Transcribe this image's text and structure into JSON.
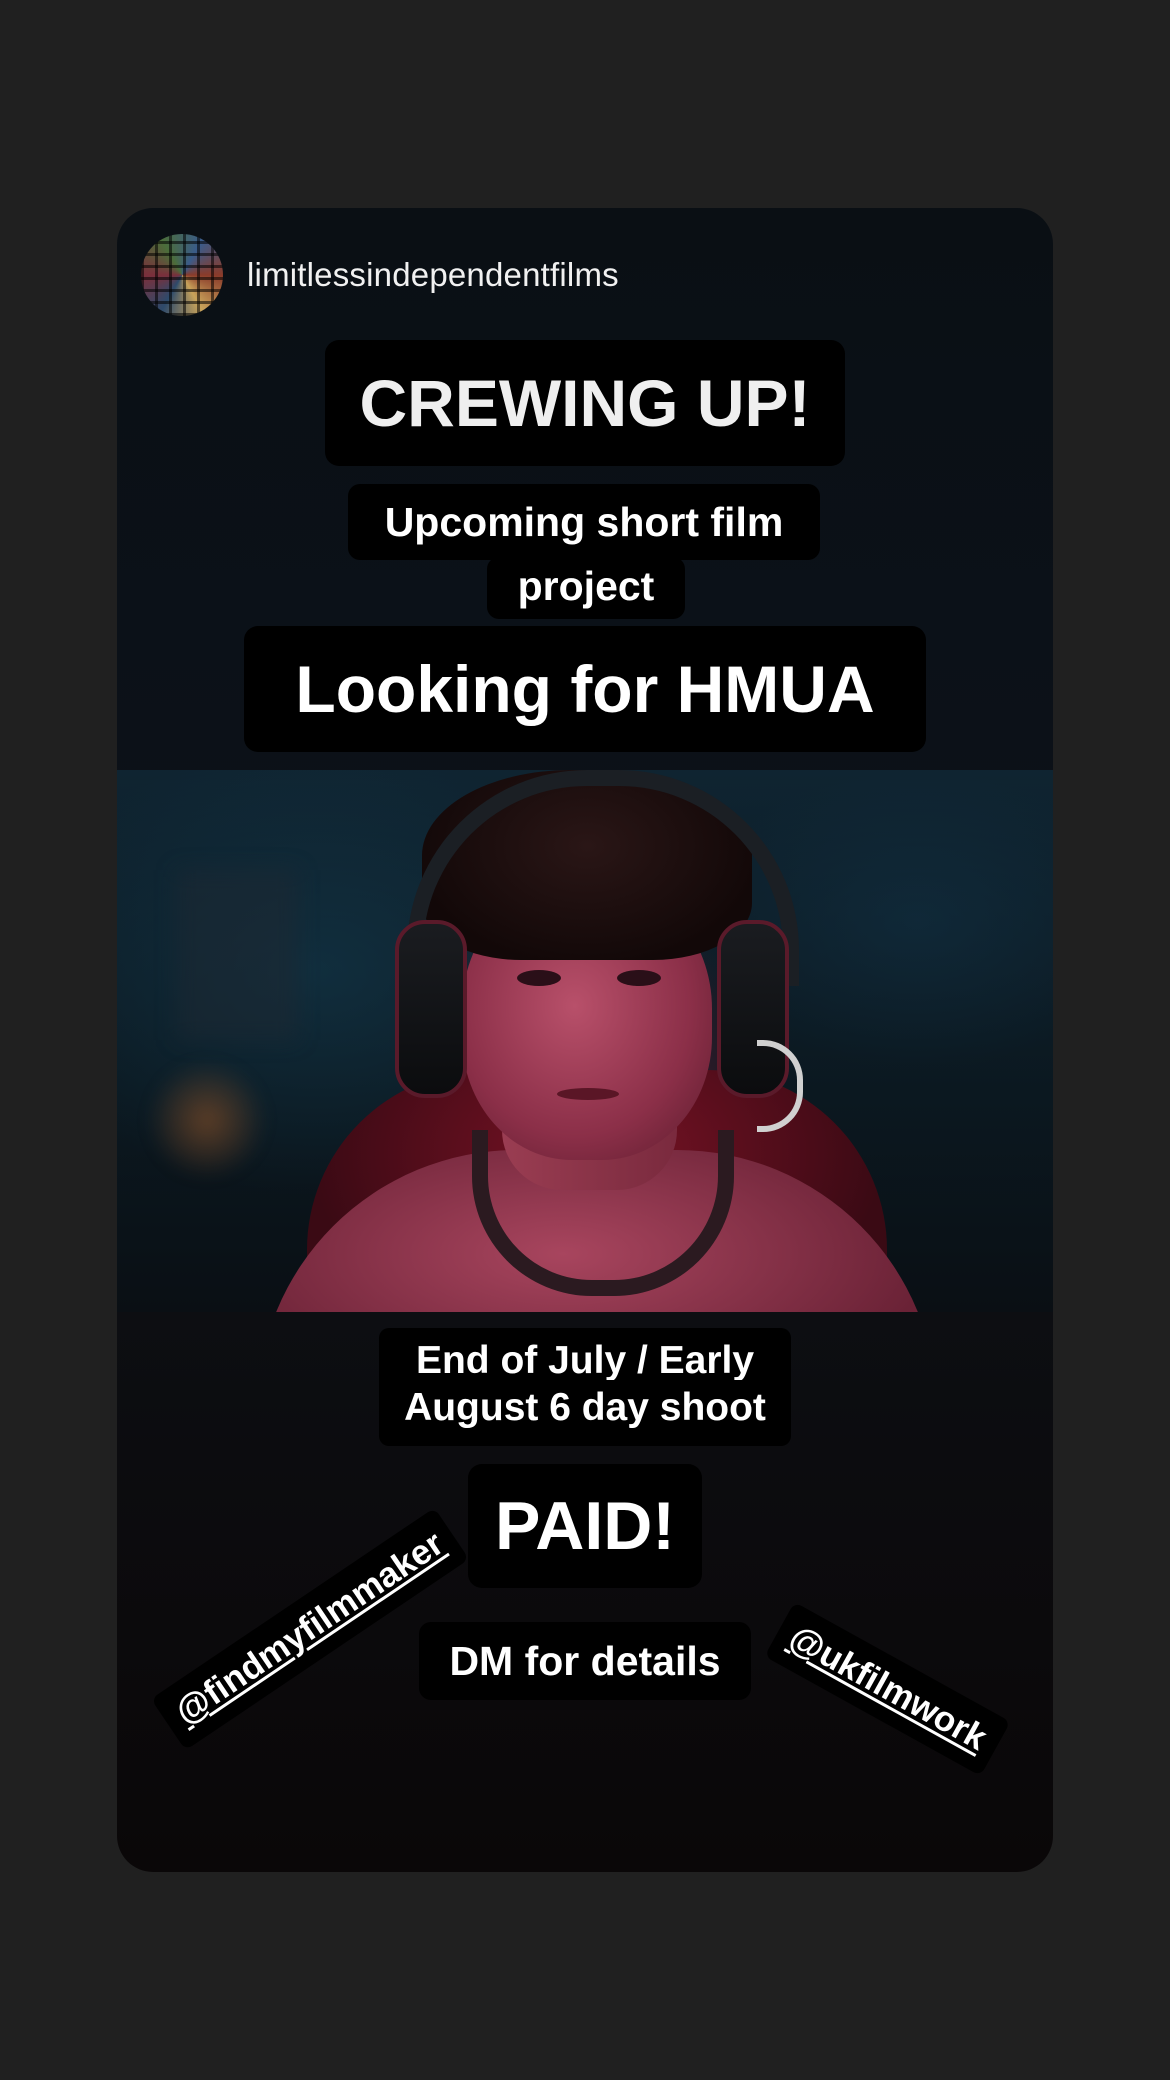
{
  "story": {
    "username": "limitlessindependentfilms",
    "headline": "CREWING UP!",
    "subtitle_line1": "Upcoming short film",
    "subtitle_line2": "project",
    "role": "Looking for HMUA",
    "dates_line1": "End of July / Early",
    "dates_line2": "August 6 day shoot",
    "pay": "PAID!",
    "cta": "DM for details",
    "mention_left": "@findmyfilmmaker",
    "mention_right": "@ukfilmwork"
  },
  "colors": {
    "page_background": "#202020",
    "sticker_background": "#000000",
    "sticker_text": "#ffffff"
  },
  "icons": {
    "avatar": "profile-avatar-collage"
  }
}
